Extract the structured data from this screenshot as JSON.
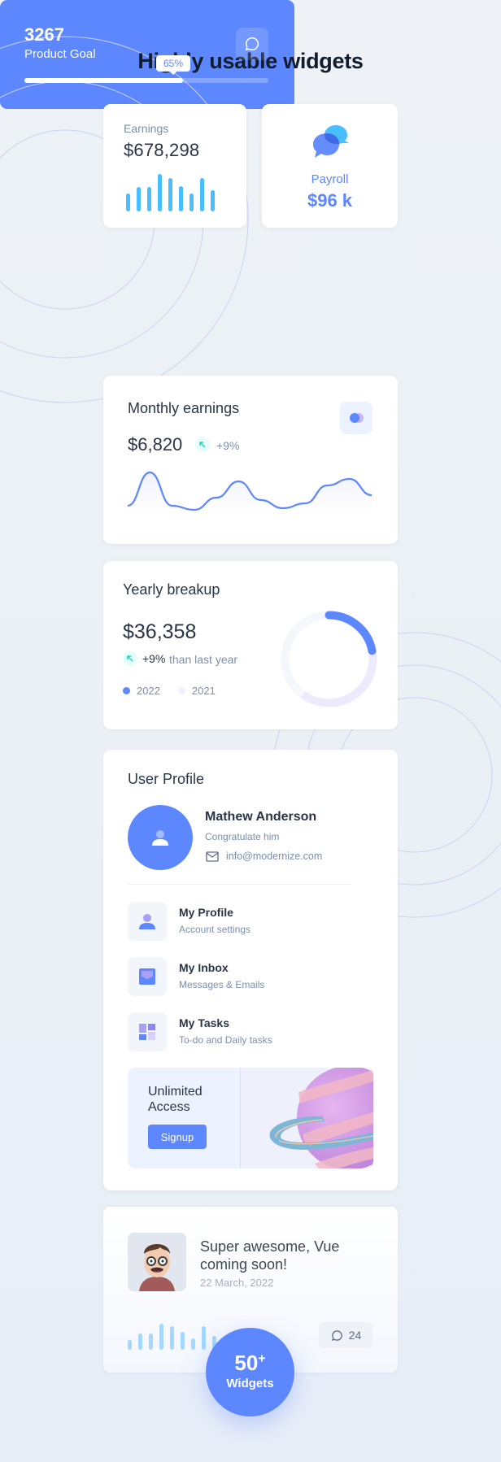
{
  "page": {
    "title": "Highly usable widgets"
  },
  "colors": {
    "primary": "#5d87ff",
    "secondary": "#49beff",
    "success": "#13deb9",
    "text": "#2a3547",
    "muted": "#7c8fac"
  },
  "earnings": {
    "label": "Earnings",
    "value": "$678,298",
    "bars": [
      0.45,
      0.62,
      0.62,
      0.95,
      0.85,
      0.65,
      0.45,
      0.85,
      0.55
    ]
  },
  "payroll": {
    "icon": "chat-bubbles-icon",
    "label": "Payroll",
    "value": "$96 k"
  },
  "product_goal": {
    "value": "3267",
    "label": "Product Goal",
    "progress_percent": 65,
    "progress_label": "65%",
    "icon": "chat-icon"
  },
  "monthly_earnings": {
    "title": "Monthly earnings",
    "value": "$6,820",
    "change": "+9%",
    "trend_icon": "arrow-up-left-icon",
    "series": [
      25,
      66,
      25,
      20,
      35,
      55,
      32,
      22,
      28,
      50,
      58,
      38
    ]
  },
  "yearly_breakup": {
    "title": "Yearly breakup",
    "value": "$36,358",
    "change": "+9%",
    "change_suffix": "than last year",
    "legend": [
      {
        "label": "2022",
        "color": "#5d87ff"
      },
      {
        "label": "2021",
        "color": "#ecf2ff"
      }
    ],
    "donut": [
      {
        "label": "2022",
        "value": 22,
        "color": "#5d87ff"
      },
      {
        "label": "2021",
        "value": 38,
        "color": "#eeeafd"
      },
      {
        "label": "other",
        "value": 40,
        "color": "#f6f7fd"
      }
    ]
  },
  "user_profile": {
    "title": "User Profile",
    "name": "Mathew Anderson",
    "subtitle": "Congratulate him",
    "email": "info@modernize.com",
    "menu": [
      {
        "title": "My Profile",
        "subtitle": "Account settings",
        "icon": "user-icon"
      },
      {
        "title": "My Inbox",
        "subtitle": "Messages & Emails",
        "icon": "inbox-icon"
      },
      {
        "title": "My Tasks",
        "subtitle": "To-do and Daily tasks",
        "icon": "tasks-icon"
      }
    ],
    "promo": {
      "headline": "Unlimited Access",
      "button": "Signup"
    }
  },
  "blog": {
    "headline": "Super awesome, Vue coming soon!",
    "date": "22 March, 2022",
    "comments": "24",
    "bars": [
      0.35,
      0.6,
      0.6,
      0.95,
      0.85,
      0.65,
      0.4,
      0.85,
      0.5
    ]
  },
  "badge": {
    "number": "50",
    "suffix": "+",
    "label": "Widgets"
  }
}
